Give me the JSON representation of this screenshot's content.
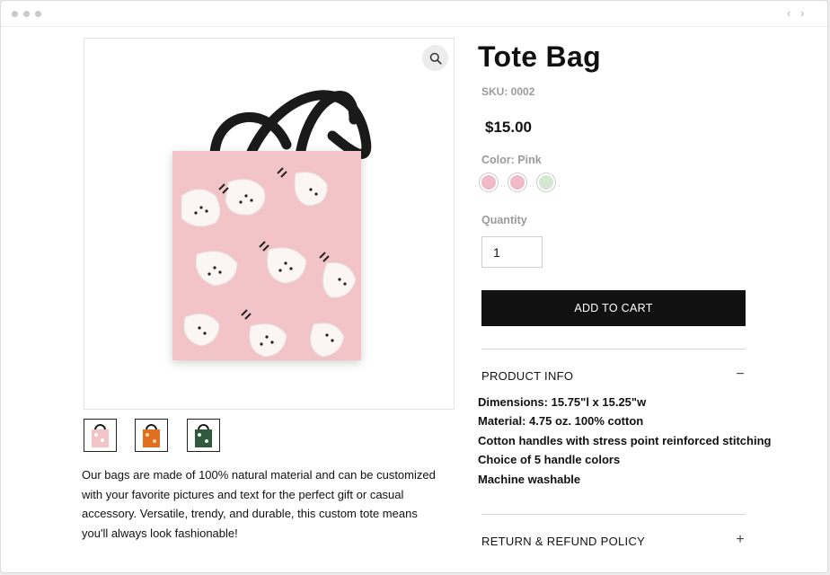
{
  "product": {
    "title": "Tote Bag",
    "sku": "SKU: 0002",
    "price": "$15.00",
    "color_label": "Color: Pink",
    "colors": [
      "#f2b9c6",
      "#f2b9c6",
      "#d5e6d2"
    ],
    "quantity_label": "Quantity",
    "quantity_value": "1",
    "add_to_cart_label": "ADD TO CART",
    "description": "Our bags are made of 100% natural material and can be customized with your favorite pictures and text for the perfect gift or casual accessory. Versatile, trendy, and durable, this custom tote means you'll always look fashionable!"
  },
  "sections": {
    "product_info": {
      "title": "PRODUCT INFO",
      "toggle": "−",
      "lines": [
        "Dimensions: 15.75\"l x 15.25\"w",
        "Material: 4.75 oz. 100% cotton",
        "Cotton handles with stress point reinforced stitching",
        "Choice of 5 handle colors",
        "Machine washable"
      ]
    },
    "return_policy": {
      "title": "RETURN & REFUND POLICY",
      "toggle": "+"
    }
  },
  "icons": {
    "zoom": "magnifier-icon",
    "window_controls": "traffic-dots-icon",
    "nav_back": "chevron-left-icon",
    "nav_forward": "chevron-right-icon"
  },
  "colors": {
    "accent": "#111111",
    "bag_pink": "#f2c4c8",
    "handle": "#1a1a1a"
  }
}
